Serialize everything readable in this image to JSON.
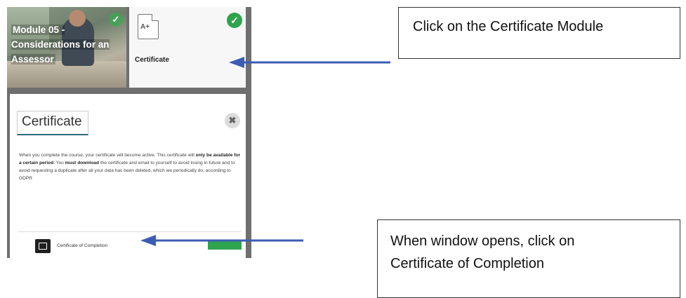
{
  "screenshot": {
    "module_tile": {
      "title": "Module 05 - Considerations for an Assessor"
    },
    "certificate_tile": {
      "icon_text": "A+",
      "label": "Certificate"
    },
    "modal": {
      "title": "Certificate",
      "close_symbol": "✖",
      "text_1": "When you complete the course, your certificate will become active. This certificate will ",
      "text_bold_1": "only be available for a certain period",
      "text_2": ". You ",
      "text_bold_2": "must download",
      "text_3": " the certificate and email to yourself to avoid losing in future and to avoid requesting a duplicate after all your data has been deleted, which we periodically do, according to GDPR",
      "certificate_item_label": "Certificate of Completion"
    }
  },
  "callouts": {
    "first": "Click on the Certificate Module",
    "second_line_1": "When window opens, click on",
    "second_line_2": "Certificate of Completion"
  },
  "colors": {
    "accent_green": "#2ea44f",
    "arrow_blue": "#3b5db4",
    "title_underline": "#2d6a7a"
  },
  "icons": {
    "check": "check-icon",
    "document": "document-grade-icon",
    "close": "close-icon",
    "certificate": "certificate-icon"
  }
}
